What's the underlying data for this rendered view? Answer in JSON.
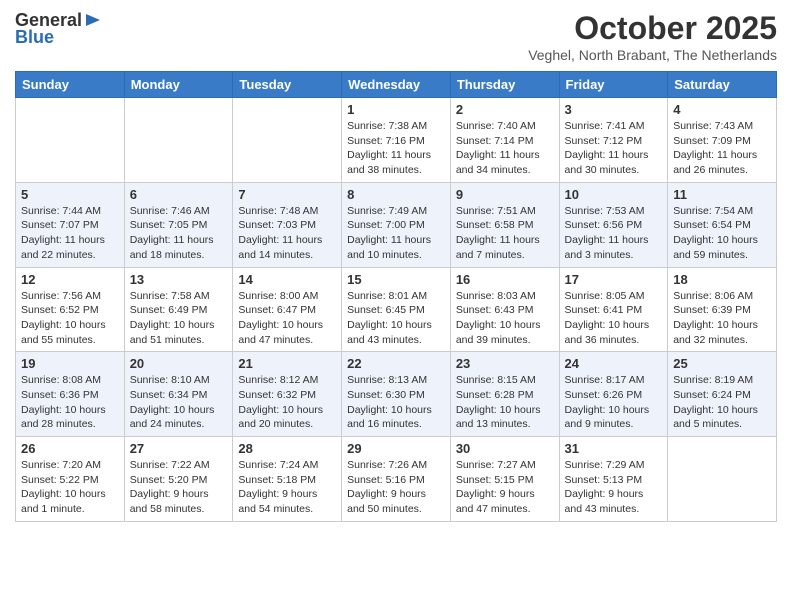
{
  "header": {
    "logo_line1": "General",
    "logo_line2": "Blue",
    "main_title": "October 2025",
    "subtitle": "Veghel, North Brabant, The Netherlands"
  },
  "days_of_week": [
    "Sunday",
    "Monday",
    "Tuesday",
    "Wednesday",
    "Thursday",
    "Friday",
    "Saturday"
  ],
  "weeks": [
    [
      {
        "day": "",
        "info": ""
      },
      {
        "day": "",
        "info": ""
      },
      {
        "day": "",
        "info": ""
      },
      {
        "day": "1",
        "info": "Sunrise: 7:38 AM\nSunset: 7:16 PM\nDaylight: 11 hours and 38 minutes."
      },
      {
        "day": "2",
        "info": "Sunrise: 7:40 AM\nSunset: 7:14 PM\nDaylight: 11 hours and 34 minutes."
      },
      {
        "day": "3",
        "info": "Sunrise: 7:41 AM\nSunset: 7:12 PM\nDaylight: 11 hours and 30 minutes."
      },
      {
        "day": "4",
        "info": "Sunrise: 7:43 AM\nSunset: 7:09 PM\nDaylight: 11 hours and 26 minutes."
      }
    ],
    [
      {
        "day": "5",
        "info": "Sunrise: 7:44 AM\nSunset: 7:07 PM\nDaylight: 11 hours and 22 minutes."
      },
      {
        "day": "6",
        "info": "Sunrise: 7:46 AM\nSunset: 7:05 PM\nDaylight: 11 hours and 18 minutes."
      },
      {
        "day": "7",
        "info": "Sunrise: 7:48 AM\nSunset: 7:03 PM\nDaylight: 11 hours and 14 minutes."
      },
      {
        "day": "8",
        "info": "Sunrise: 7:49 AM\nSunset: 7:00 PM\nDaylight: 11 hours and 10 minutes."
      },
      {
        "day": "9",
        "info": "Sunrise: 7:51 AM\nSunset: 6:58 PM\nDaylight: 11 hours and 7 minutes."
      },
      {
        "day": "10",
        "info": "Sunrise: 7:53 AM\nSunset: 6:56 PM\nDaylight: 11 hours and 3 minutes."
      },
      {
        "day": "11",
        "info": "Sunrise: 7:54 AM\nSunset: 6:54 PM\nDaylight: 10 hours and 59 minutes."
      }
    ],
    [
      {
        "day": "12",
        "info": "Sunrise: 7:56 AM\nSunset: 6:52 PM\nDaylight: 10 hours and 55 minutes."
      },
      {
        "day": "13",
        "info": "Sunrise: 7:58 AM\nSunset: 6:49 PM\nDaylight: 10 hours and 51 minutes."
      },
      {
        "day": "14",
        "info": "Sunrise: 8:00 AM\nSunset: 6:47 PM\nDaylight: 10 hours and 47 minutes."
      },
      {
        "day": "15",
        "info": "Sunrise: 8:01 AM\nSunset: 6:45 PM\nDaylight: 10 hours and 43 minutes."
      },
      {
        "day": "16",
        "info": "Sunrise: 8:03 AM\nSunset: 6:43 PM\nDaylight: 10 hours and 39 minutes."
      },
      {
        "day": "17",
        "info": "Sunrise: 8:05 AM\nSunset: 6:41 PM\nDaylight: 10 hours and 36 minutes."
      },
      {
        "day": "18",
        "info": "Sunrise: 8:06 AM\nSunset: 6:39 PM\nDaylight: 10 hours and 32 minutes."
      }
    ],
    [
      {
        "day": "19",
        "info": "Sunrise: 8:08 AM\nSunset: 6:36 PM\nDaylight: 10 hours and 28 minutes."
      },
      {
        "day": "20",
        "info": "Sunrise: 8:10 AM\nSunset: 6:34 PM\nDaylight: 10 hours and 24 minutes."
      },
      {
        "day": "21",
        "info": "Sunrise: 8:12 AM\nSunset: 6:32 PM\nDaylight: 10 hours and 20 minutes."
      },
      {
        "day": "22",
        "info": "Sunrise: 8:13 AM\nSunset: 6:30 PM\nDaylight: 10 hours and 16 minutes."
      },
      {
        "day": "23",
        "info": "Sunrise: 8:15 AM\nSunset: 6:28 PM\nDaylight: 10 hours and 13 minutes."
      },
      {
        "day": "24",
        "info": "Sunrise: 8:17 AM\nSunset: 6:26 PM\nDaylight: 10 hours and 9 minutes."
      },
      {
        "day": "25",
        "info": "Sunrise: 8:19 AM\nSunset: 6:24 PM\nDaylight: 10 hours and 5 minutes."
      }
    ],
    [
      {
        "day": "26",
        "info": "Sunrise: 7:20 AM\nSunset: 5:22 PM\nDaylight: 10 hours and 1 minute."
      },
      {
        "day": "27",
        "info": "Sunrise: 7:22 AM\nSunset: 5:20 PM\nDaylight: 9 hours and 58 minutes."
      },
      {
        "day": "28",
        "info": "Sunrise: 7:24 AM\nSunset: 5:18 PM\nDaylight: 9 hours and 54 minutes."
      },
      {
        "day": "29",
        "info": "Sunrise: 7:26 AM\nSunset: 5:16 PM\nDaylight: 9 hours and 50 minutes."
      },
      {
        "day": "30",
        "info": "Sunrise: 7:27 AM\nSunset: 5:15 PM\nDaylight: 9 hours and 47 minutes."
      },
      {
        "day": "31",
        "info": "Sunrise: 7:29 AM\nSunset: 5:13 PM\nDaylight: 9 hours and 43 minutes."
      },
      {
        "day": "",
        "info": ""
      }
    ]
  ]
}
